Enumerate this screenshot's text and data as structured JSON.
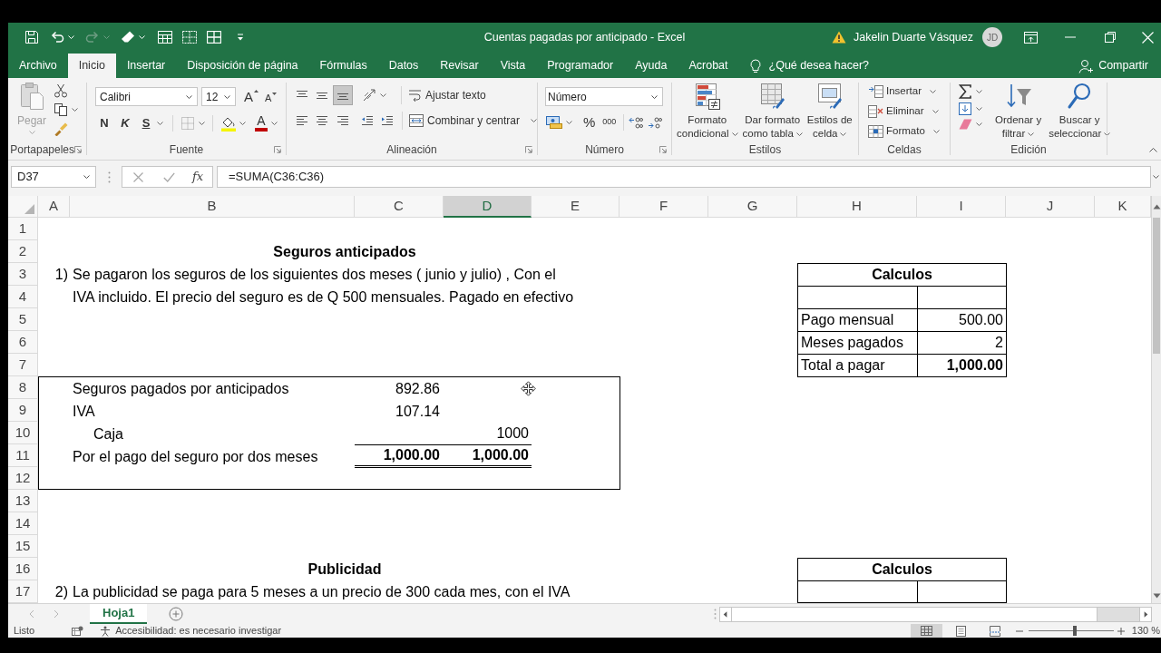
{
  "window": {
    "title": "Cuentas pagadas por anticipado - Excel",
    "user": "Jakelin Duarte Vásquez",
    "avatar": "JD"
  },
  "quick_access": {
    "redo_disabled": true
  },
  "tabs": [
    {
      "label": "Archivo",
      "selected": false
    },
    {
      "label": "Inicio",
      "selected": true
    },
    {
      "label": "Insertar",
      "selected": false
    },
    {
      "label": "Disposición de página",
      "selected": false
    },
    {
      "label": "Fórmulas",
      "selected": false
    },
    {
      "label": "Datos",
      "selected": false
    },
    {
      "label": "Revisar",
      "selected": false
    },
    {
      "label": "Vista",
      "selected": false
    },
    {
      "label": "Programador",
      "selected": false
    },
    {
      "label": "Ayuda",
      "selected": false
    },
    {
      "label": "Acrobat",
      "selected": false
    }
  ],
  "tell_me": "¿Qué desea hacer?",
  "share": "Compartir",
  "ribbon": {
    "clipboard": {
      "label": "Portapapeles",
      "paste": "Pegar",
      "paste_disabled": true
    },
    "font": {
      "label": "Fuente",
      "font_name": "Calibri",
      "font_size": "12",
      "grow": "A",
      "shrink": "A",
      "bold": "N",
      "italic": "K",
      "underline": "S",
      "font_color": "A"
    },
    "alignment": {
      "label": "Alineación",
      "wrap_text": "Ajustar texto",
      "merge_center": "Combinar y centrar",
      "bottom_align_selected": true
    },
    "number": {
      "label": "Número",
      "format": "Número",
      "percent": "%",
      "thousands": "000"
    },
    "styles": {
      "label": "Estilos",
      "buttons": [
        "Formato\ncondicional",
        "Dar formato\ncomo tabla",
        "Estilos de\ncelda"
      ]
    },
    "cells": {
      "label": "Celdas",
      "buttons": [
        "Insertar",
        "Eliminar",
        "Formato"
      ]
    },
    "editing": {
      "label": "Edición",
      "buttons": [
        "Ordenar y\nfiltrar",
        "Buscar y\nseleccionar"
      ]
    }
  },
  "formula_bar": {
    "name_box": "D37",
    "insert_function": "fx",
    "formula": "=SUMA(C36:C36)"
  },
  "sheet": {
    "columns": [
      {
        "label": "A",
        "selected": false
      },
      {
        "label": "B",
        "selected": false
      },
      {
        "label": "C",
        "selected": false
      },
      {
        "label": "D",
        "selected": true
      },
      {
        "label": "E",
        "selected": false
      },
      {
        "label": "F",
        "selected": false
      },
      {
        "label": "G",
        "selected": false
      },
      {
        "label": "H",
        "selected": false
      },
      {
        "label": "I",
        "selected": false
      },
      {
        "label": "J",
        "selected": false
      },
      {
        "label": "K",
        "selected": false
      }
    ],
    "rows": [
      "1",
      "2",
      "3",
      "4",
      "5",
      "6",
      "7",
      "8",
      "9",
      "10",
      "11",
      "12",
      "13",
      "14",
      "15",
      "16",
      "17"
    ],
    "section_1": {
      "title": "Seguros anticipados",
      "number": "1)",
      "statement": "Se pagaron los seguros de los siguientes dos meses ( junio y julio) , Con el\nIVA incluido. El precio del seguro es de Q 500 mensuales. Pagado en efectivo"
    },
    "journal_entry": {
      "lines": [
        {
          "account": "Seguros pagados por anticipados",
          "debit": "892.86",
          "indented": false
        },
        {
          "account": "IVA",
          "debit": "107.14",
          "indented": false
        },
        {
          "account": "Caja",
          "credit": "1000",
          "indented": true
        }
      ],
      "total": {
        "description": "Por el pago del seguro por dos meses",
        "debit": "1,000.00",
        "credit": "1,000.00"
      }
    },
    "calc_table_1": {
      "title": "Calculos",
      "rows": [
        {
          "label": "Pago mensual",
          "value": "500.00",
          "bold": false
        },
        {
          "label": "Meses pagados",
          "value": "2",
          "bold": false
        },
        {
          "label": "Total a pagar",
          "value": "1,000.00",
          "bold": true
        }
      ]
    },
    "section_2": {
      "title": "Publicidad",
      "number": "2)",
      "statement": "La publicidad se paga para 5 meses a un precio de 300 cada mes, con el IVA"
    },
    "calc_table_2": {
      "title": "Calculos"
    }
  },
  "sheet_tabs": [
    {
      "label": "Hoja1",
      "selected": true
    }
  ],
  "status_bar": {
    "status": "Listo",
    "accessibility": "Accesibilidad: es necesario investigar",
    "views": [
      {
        "kind": "normal",
        "selected": true
      },
      {
        "kind": "page_layout",
        "selected": false
      },
      {
        "kind": "page_break",
        "selected": false
      }
    ],
    "zoom": {
      "label": "130 %",
      "level": 0.55
    }
  }
}
